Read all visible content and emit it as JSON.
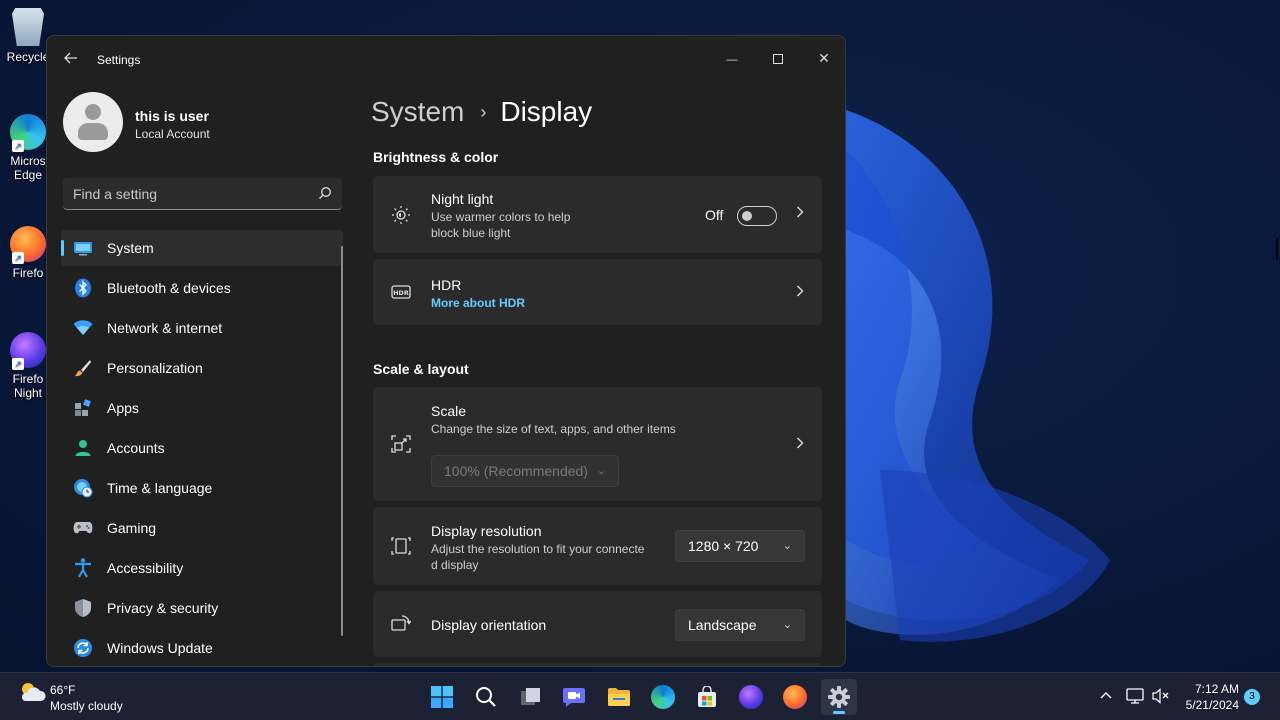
{
  "desktop": {
    "icons": [
      {
        "label": "Recycle",
        "icon": "recycle-bin-icon"
      },
      {
        "label": "Micros Edge",
        "icon": "edge-icon"
      },
      {
        "label": "Firefo",
        "icon": "firefox-icon"
      },
      {
        "label": "Firefo Night",
        "icon": "firefox-nightly-icon"
      }
    ]
  },
  "window": {
    "title": "Settings",
    "back_icon": "back-arrow-icon",
    "minimize_glyph": "—",
    "maximize_glyph": "☐",
    "close_glyph": "✕"
  },
  "user": {
    "name": "this is user",
    "account_type": "Local Account"
  },
  "search": {
    "placeholder": "Find a setting"
  },
  "nav": {
    "items": [
      {
        "label": "System",
        "icon": "monitor-icon",
        "active": true
      },
      {
        "label": "Bluetooth & devices",
        "icon": "bluetooth-icon"
      },
      {
        "label": "Network & internet",
        "icon": "wifi-icon"
      },
      {
        "label": "Personalization",
        "icon": "brush-icon"
      },
      {
        "label": "Apps",
        "icon": "apps-icon"
      },
      {
        "label": "Accounts",
        "icon": "accounts-icon"
      },
      {
        "label": "Time & language",
        "icon": "globe-clock-icon"
      },
      {
        "label": "Gaming",
        "icon": "gamepad-icon"
      },
      {
        "label": "Accessibility",
        "icon": "accessibility-icon"
      },
      {
        "label": "Privacy & security",
        "icon": "shield-icon"
      },
      {
        "label": "Windows Update",
        "icon": "update-icon"
      }
    ]
  },
  "breadcrumb": {
    "parent": "System",
    "separator": "›",
    "current": "Display"
  },
  "sections": {
    "brightness": {
      "title": "Brightness & color",
      "night_light": {
        "title": "Night light",
        "subtitle_line1": "Use warmer colors to help",
        "subtitle_line2": "block blue light",
        "state_label": "Off",
        "toggle_on": false
      },
      "hdr": {
        "title": "HDR",
        "link": "More about HDR"
      }
    },
    "scale_layout": {
      "title": "Scale & layout",
      "scale": {
        "title": "Scale",
        "subtitle": "Change the size of text, apps, and other items",
        "value": "100% (Recommended)"
      },
      "resolution": {
        "title": "Display resolution",
        "subtitle_line1": "Adjust the resolution to fit your connecte",
        "subtitle_line2": "d display",
        "value": "1280 × 720"
      },
      "orientation": {
        "title": "Display orientation",
        "value": "Landscape"
      }
    }
  },
  "taskbar": {
    "weather_temp": "66°F",
    "weather_desc": "Mostly cloudy",
    "apps": [
      {
        "name": "start",
        "icon": "windows-start-icon"
      },
      {
        "name": "search",
        "icon": "search-icon"
      },
      {
        "name": "task-view",
        "icon": "task-view-icon"
      },
      {
        "name": "meet",
        "icon": "video-chat-icon"
      },
      {
        "name": "file-explorer",
        "icon": "folder-icon"
      },
      {
        "name": "edge",
        "icon": "edge-icon"
      },
      {
        "name": "store",
        "icon": "store-icon"
      },
      {
        "name": "firefox-nightly",
        "icon": "firefox-nightly-icon"
      },
      {
        "name": "firefox",
        "icon": "firefox-icon"
      },
      {
        "name": "settings",
        "icon": "gear-icon",
        "active": true
      }
    ],
    "time": "7:12 AM",
    "date": "5/21/2024",
    "notification_count": "3"
  },
  "colors": {
    "accent": "#60cdff",
    "window_bg": "#202020",
    "card_bg": "#2b2b2b",
    "link": "#60cdff"
  }
}
